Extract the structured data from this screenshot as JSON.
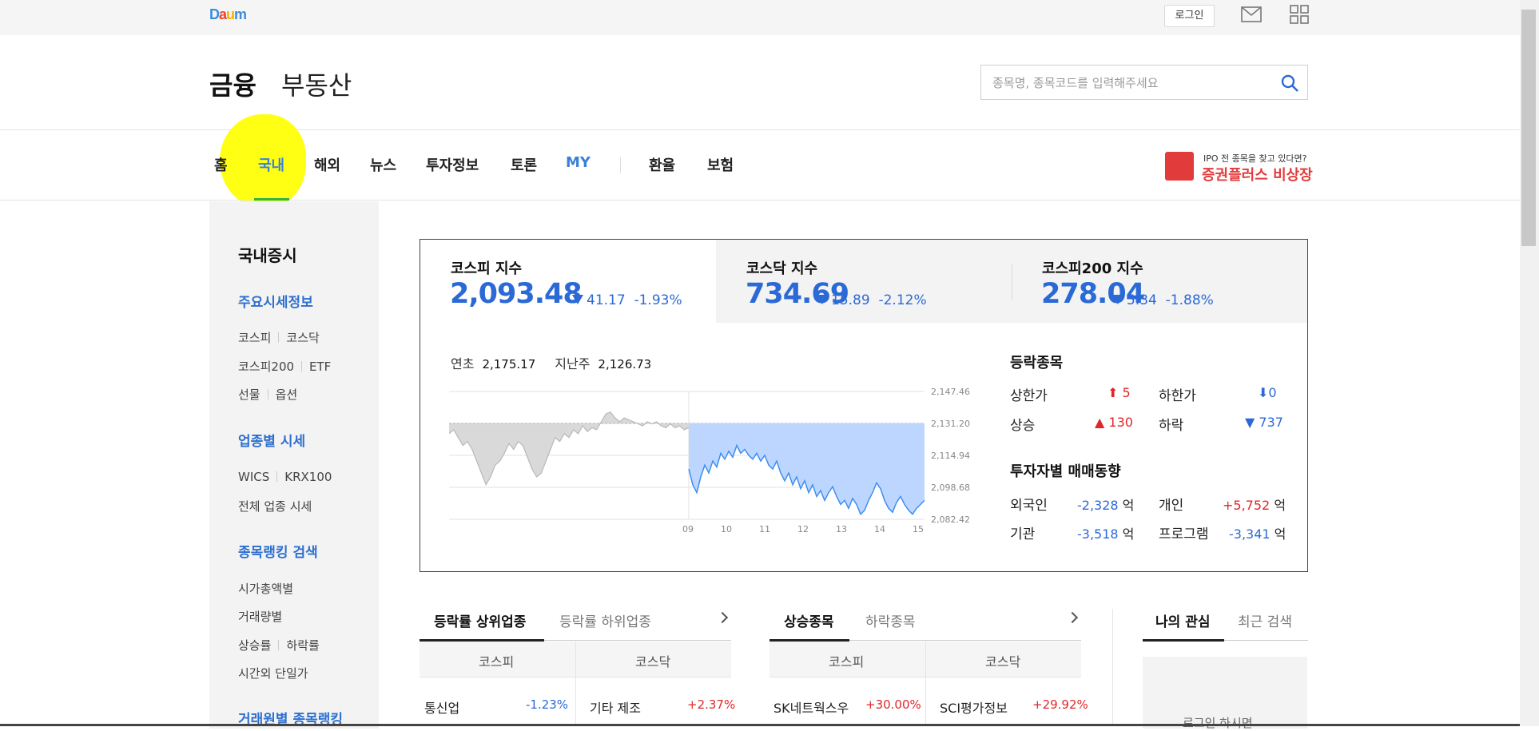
{
  "topbar": {
    "logo": "Daum",
    "login_label": "로그인"
  },
  "header": {
    "section_finance": "금융",
    "section_realestate": "부동산",
    "search_placeholder": "종목명, 종목코드를 입력해주세요"
  },
  "nav": {
    "items": [
      "홈",
      "국내",
      "해외",
      "뉴스",
      "투자정보",
      "토론",
      "MY",
      "환율",
      "보험"
    ],
    "active": "국내",
    "ad_top": "IPO 전 종목을 찾고 있다면?",
    "ad_main": "증권플러스 비상장"
  },
  "sidebar": {
    "title": "국내증시",
    "h1": "주요시세정보",
    "l1a": "코스피",
    "l1b": "코스닥",
    "l2a": "코스피200",
    "l2b": "ETF",
    "l3a": "선물",
    "l3b": "옵션",
    "h2": "업종별 시세",
    "l4a": "WICS",
    "l4b": "KRX100",
    "l5": "전체 업종 시세",
    "h3": "종목랭킹 검색",
    "l6": "시가총액별",
    "l7": "거래량별",
    "l8a": "상승률",
    "l8b": "하락률",
    "l9": "시간외 단일가",
    "h4": "거래원별 종목랭킹"
  },
  "indices": [
    {
      "name": "코스피 지수",
      "value": "2,093.48",
      "change": "41.17",
      "rate": "-1.93%"
    },
    {
      "name": "코스닥 지수",
      "value": "734.69",
      "change": "15.89",
      "rate": "-2.12%"
    },
    {
      "name": "코스피200 지수",
      "value": "278.04",
      "change": "5.34",
      "rate": "-1.88%"
    }
  ],
  "chart_info": {
    "ytd_label": "연초",
    "ytd_value": "2,175.17",
    "lastweek_label": "지난주",
    "lastweek_value": "2,126.73"
  },
  "chart_data": {
    "type": "area",
    "y_ticks": [
      "2,147.46",
      "2,131.20",
      "2,114.94",
      "2,098.68",
      "2,082.42"
    ],
    "ylim": [
      2082.42,
      2147.46
    ],
    "x_ticks": [
      "09",
      "10",
      "11",
      "12",
      "13",
      "14",
      "15"
    ],
    "series": [
      {
        "values": [
          2126,
          2128,
          2124,
          2120,
          2122,
          2118,
          2112,
          2106,
          2100,
          2104,
          2110,
          2112,
          2116,
          2121,
          2118,
          2122,
          2120,
          2114,
          2108,
          2104,
          2106,
          2112,
          2118,
          2124,
          2122,
          2126,
          2124,
          2128,
          2126,
          2130,
          2127,
          2129,
          2128,
          2132,
          2136,
          2137,
          2134,
          2132,
          2134,
          2133,
          2132,
          2131,
          2130,
          2132,
          2131,
          2132,
          2130,
          2129,
          2131,
          2129,
          2130,
          2128,
          2129
        ]
      },
      {
        "values": [
          2108,
          2100,
          2096,
          2104,
          2110,
          2106,
          2112,
          2109,
          2116,
          2113,
          2117,
          2114,
          2120,
          2116,
          2118,
          2115,
          2113,
          2116,
          2112,
          2115,
          2110,
          2108,
          2112,
          2106,
          2102,
          2106,
          2100,
          2104,
          2098,
          2102,
          2096,
          2100,
          2094,
          2097,
          2092,
          2096,
          2099,
          2094,
          2090,
          2092,
          2088,
          2093,
          2090,
          2085,
          2087,
          2092,
          2096,
          2101,
          2098,
          2092,
          2088,
          2086,
          2091,
          2094,
          2090,
          2087,
          2085,
          2088,
          2090,
          2092
        ]
      }
    ]
  },
  "stats": {
    "title1": "등락종목",
    "upper_label": "상한가",
    "upper": "5",
    "lower_label": "하한가",
    "lower": "0",
    "rise_label": "상승",
    "rise": "130",
    "fall_label": "하락",
    "fall": "737",
    "title2": "투자자별 매매동향",
    "foreign_label": "외국인",
    "foreign": "-2,328",
    "indiv_label": "개인",
    "indiv": "+5,752",
    "inst_label": "기관",
    "inst": "-3,518",
    "prog_label": "프로그램",
    "prog": "-3,341",
    "unit": "억"
  },
  "bottom": {
    "tab1_on": "등락률 상위업종",
    "tab1_off": "등락률 하위업종",
    "tab2_on": "상승종목",
    "tab2_off": "하락종목",
    "tab3_on": "나의 관심",
    "tab3_off": "최근 검색",
    "col_kospi": "코스피",
    "col_kosdaq": "코스닥",
    "r1": "통신업",
    "r1v": "-1.23%",
    "r2": "기타 제조",
    "r2v": "+2.37%",
    "r3": "SK네트웍스우",
    "r3v": "+30.00%",
    "r4": "SCI평가정보",
    "r4v": "+29.92%",
    "login_hint": "로그인 하시면"
  }
}
